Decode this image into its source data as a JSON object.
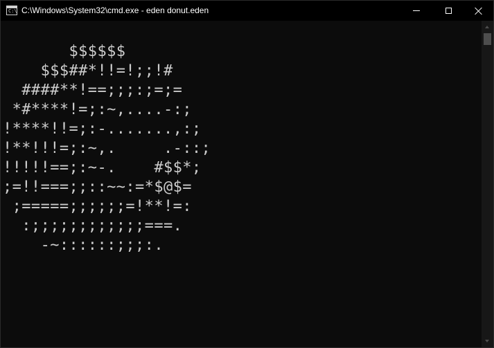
{
  "window": {
    "title": "C:\\Windows\\System32\\cmd.exe - eden  donut.eden",
    "icon": "cmd-icon",
    "icon_glyph": "C:\\"
  },
  "console": {
    "output": "       $$$$$$\n    $$$##*!!=!;;!#\n  ####**!==;;;:;=;=\n *#****!=;:~,....-:;\n!****!!=;:-.......,:;\n!**!!!=;:~,.     .-::;\n!!!!!==;:~-.    #$$*;\n;=!!===;;::~~:=*$@$=\n ;=====;;;;;;=!**!=:\n  :;;;;;;;;;;;;===.\n    -~::::::;;;:.",
    "foreground_color": "#cccccc",
    "background_color": "#0c0c0c"
  },
  "controls": {
    "minimize": "minimize-icon",
    "maximize": "maximize-icon",
    "close": "close-icon"
  }
}
